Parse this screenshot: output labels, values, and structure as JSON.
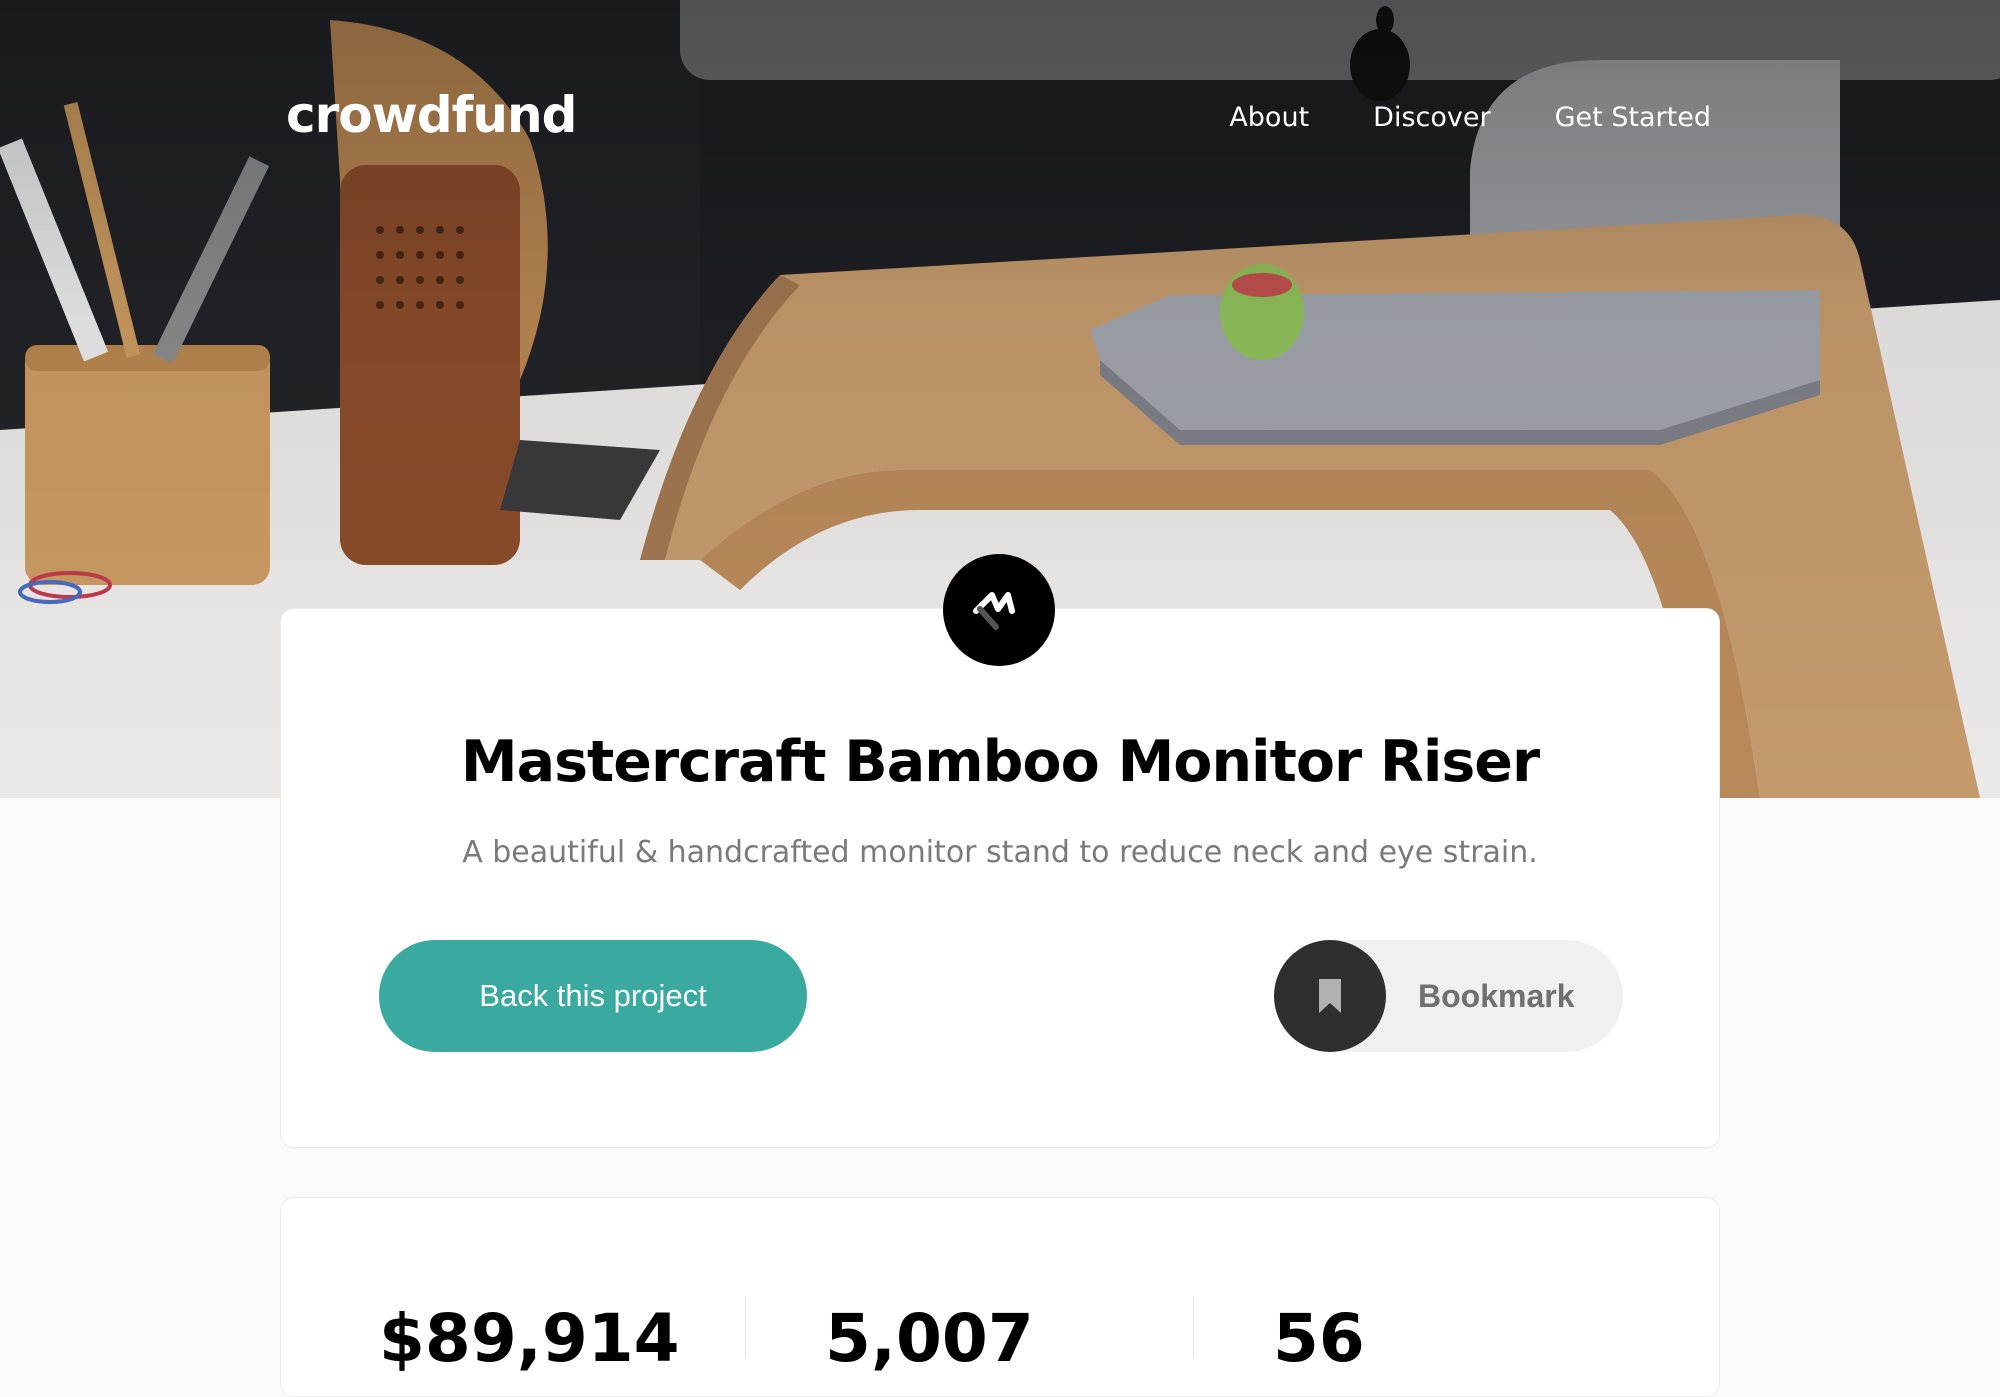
{
  "header": {
    "logo": "crowdfund",
    "nav": [
      {
        "label": "About"
      },
      {
        "label": "Discover"
      },
      {
        "label": "Get Started"
      }
    ]
  },
  "project": {
    "title": "Mastercraft Bamboo Monitor Riser",
    "subtitle": "A beautiful & handcrafted monitor stand to reduce neck and eye strain.",
    "back_label": "Back this project",
    "bookmark_label": "Bookmark",
    "brand_icon": "mastercraft-logo-icon",
    "bookmark_icon": "bookmark-icon"
  },
  "stats": [
    {
      "value": "$89,914"
    },
    {
      "value": "5,007"
    },
    {
      "value": "56"
    }
  ],
  "colors": {
    "accent": "#3aaaa0",
    "dark": "#2f2f2f",
    "text_muted": "#7a7a7a"
  }
}
